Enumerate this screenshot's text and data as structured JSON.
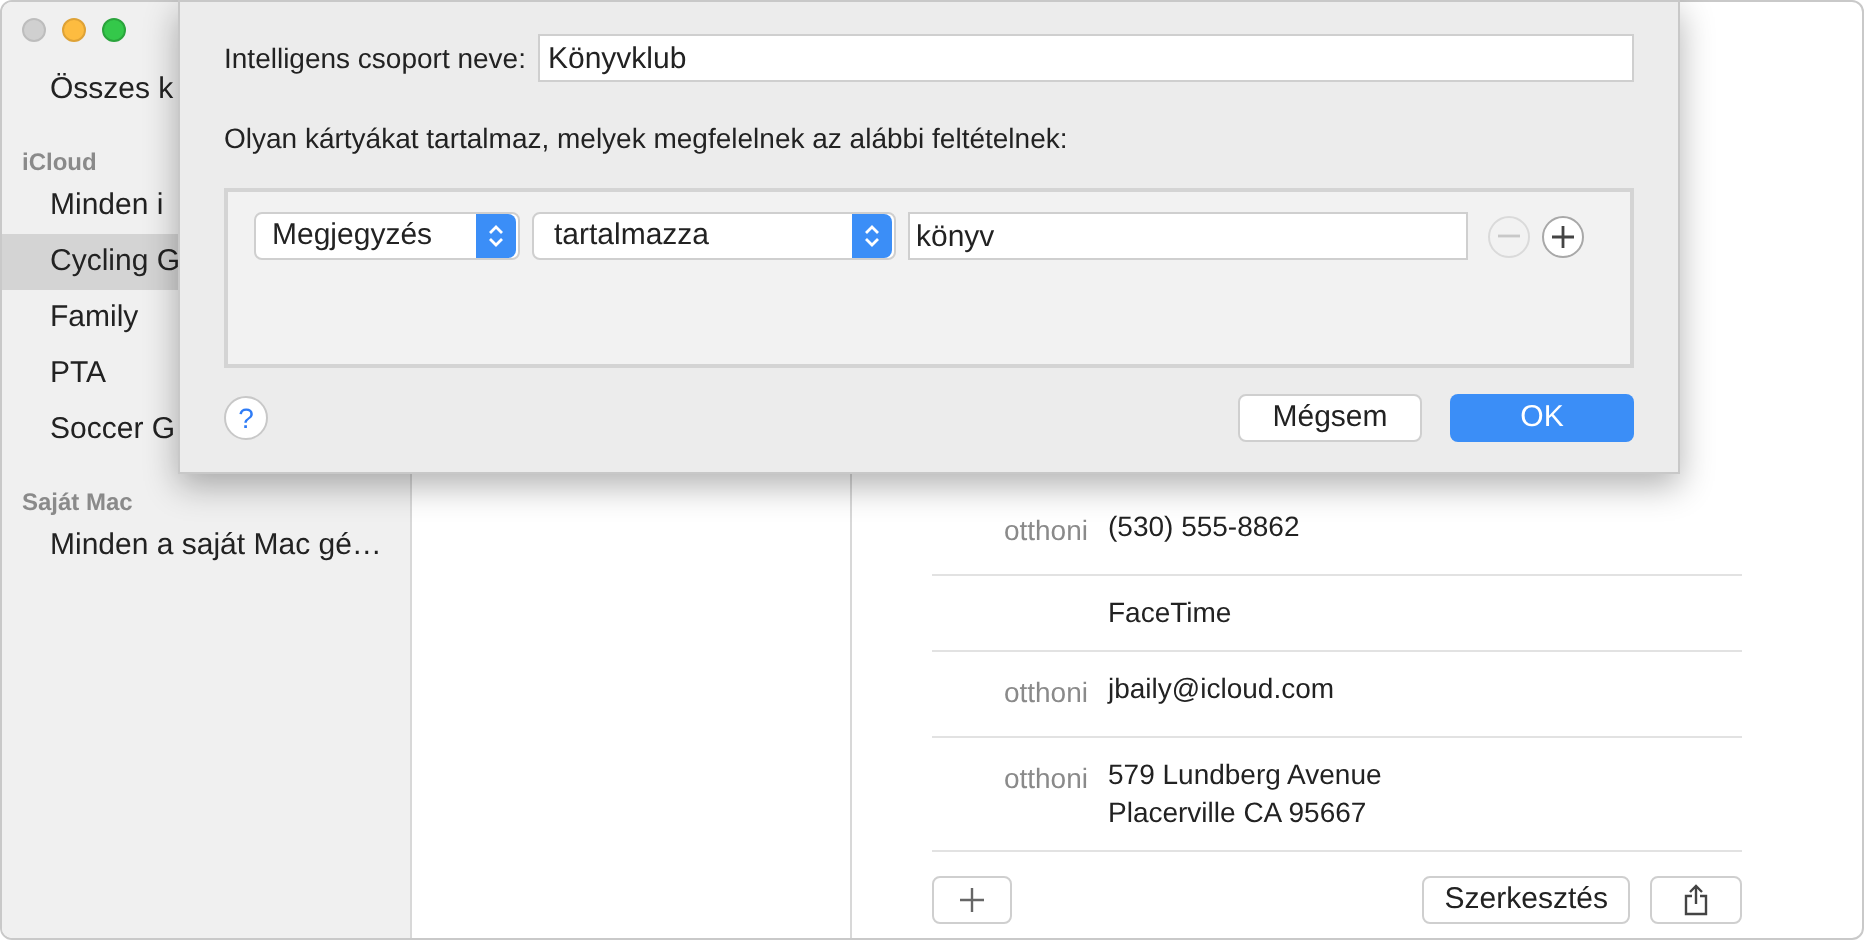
{
  "sidebar": {
    "items": [
      {
        "kind": "item",
        "label": "Összes k",
        "selected": false
      },
      {
        "kind": "header",
        "label": "iCloud"
      },
      {
        "kind": "item",
        "label": "Minden i",
        "selected": false
      },
      {
        "kind": "item",
        "label": "Cycling G",
        "selected": true
      },
      {
        "kind": "item",
        "label": "Family",
        "selected": false
      },
      {
        "kind": "item",
        "label": "PTA",
        "selected": false
      },
      {
        "kind": "item",
        "label": "Soccer G",
        "selected": false
      },
      {
        "kind": "header",
        "label": "Saját Mac"
      },
      {
        "kind": "item",
        "label": "Minden a saját Mac gé…",
        "selected": false
      }
    ]
  },
  "detail": {
    "fields": [
      {
        "label": "otthoni",
        "lines": [
          "(530) 555-8862"
        ]
      },
      {
        "lines": [
          "FaceTime"
        ]
      },
      {
        "label": "otthoni",
        "lines": [
          "jbaily@icloud.com"
        ]
      },
      {
        "label": "otthoni",
        "lines": [
          "579 Lundberg Avenue",
          "Placerville CA 95667"
        ]
      }
    ],
    "edit_button": "Szerkesztés"
  },
  "dialog": {
    "name_label": "Intelligens csoport neve:",
    "name_value": "Könyvklub",
    "criteria_label": "Olyan kártyákat tartalmaz, melyek megfelelnek az alábbi feltételnek:",
    "rules": [
      {
        "field": "Megjegyzés",
        "operator": "tartalmazza",
        "value": "könyv",
        "remove_disabled": true
      }
    ],
    "help": "?",
    "cancel": "Mégsem",
    "ok": "OK"
  }
}
